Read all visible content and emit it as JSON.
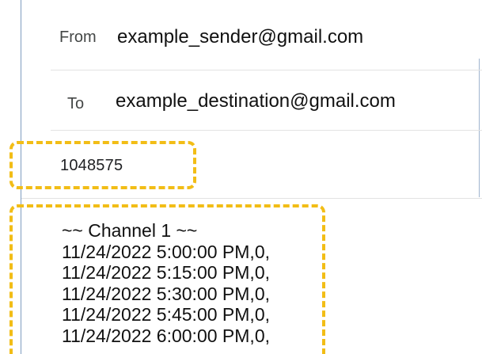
{
  "email": {
    "from_label": "From",
    "from_value": "example_sender@gmail.com",
    "to_label": "To",
    "to_value": "example_destination@gmail.com",
    "subject_value": "1048575",
    "body_lines": [
      "~~ Channel 1 ~~",
      "11/24/2022 5:00:00 PM,0,",
      "11/24/2022 5:15:00 PM,0,",
      "11/24/2022 5:30:00 PM,0,",
      "11/24/2022 5:45:00 PM,0,",
      "11/24/2022 6:00:00 PM,0,"
    ]
  },
  "colors": {
    "highlight": "#f2bd16",
    "label": "#444746",
    "text": "#111111",
    "divider": "#e3e3e3"
  }
}
